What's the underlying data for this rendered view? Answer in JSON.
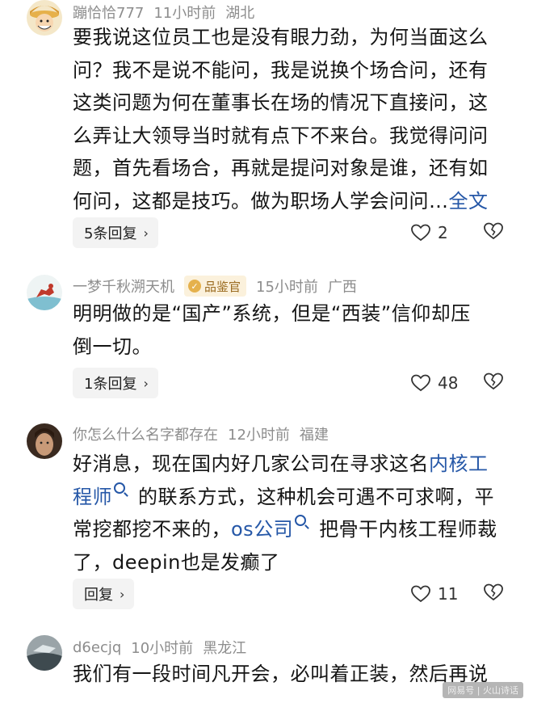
{
  "comments": [
    {
      "author": "蹦恰恰777",
      "time": "11小时前",
      "location": "湖北",
      "badge": "",
      "lines": [
        "要我说这位员工也是没有眼力劲，为何当面这么",
        "问？我不是说不能问，我是说换个场合问，还有",
        "这类问题为何在董事长在场的情况下直接问，这",
        "么弄让大领导当时就有点下不来台。我觉得问问",
        "题，首先看场合，再就是提问对象是谁，还有如",
        "何问，这都是技巧。做为职场人学会问问…"
      ],
      "full_text_link": "全文",
      "reply_label": "5条回复",
      "likes": "2"
    },
    {
      "author": "一梦千秋溯天机",
      "badge": "品鉴官",
      "time": "15小时前",
      "location": "广西",
      "lines": [
        "明明做的是“国产”系统，但是“西装”信仰却压",
        "倒一切。"
      ],
      "reply_label": "1条回复",
      "likes": "48"
    },
    {
      "author": "你怎么什么名字都存在",
      "time": "12小时前",
      "location": "福建",
      "badge": "",
      "line1_pre": "好消息，现在国内好几家公司在寻求这名",
      "line1_link": "内核工",
      "line2_link": "程师",
      "line2_post": "的联系方式，这种机会可遇不可求啊，平",
      "line3_pre": "常挖都挖不来的，",
      "line3_link": "os公司",
      "line3_post": "把骨干内核工程师裁",
      "line4": "了，deepin也是发癫了",
      "reply_label": "回复",
      "likes": "11"
    },
    {
      "author": "d6ecjq",
      "time": "10小时前",
      "location": "黑龙江",
      "badge": "",
      "lines": [
        "我们有一段时间凡开会，必叫着正装，然后再说"
      ]
    }
  ],
  "watermark": "网易号 | 火山诗话",
  "icons": {
    "like": "heart-outline-icon",
    "dislike": "heart-broken-outline-icon",
    "chevron": "chevron-right-icon",
    "search": "search-small-icon"
  },
  "colors": {
    "link": "#2557a7",
    "meta": "#8d8d8d",
    "badge_bg": "#fbf1dc"
  }
}
